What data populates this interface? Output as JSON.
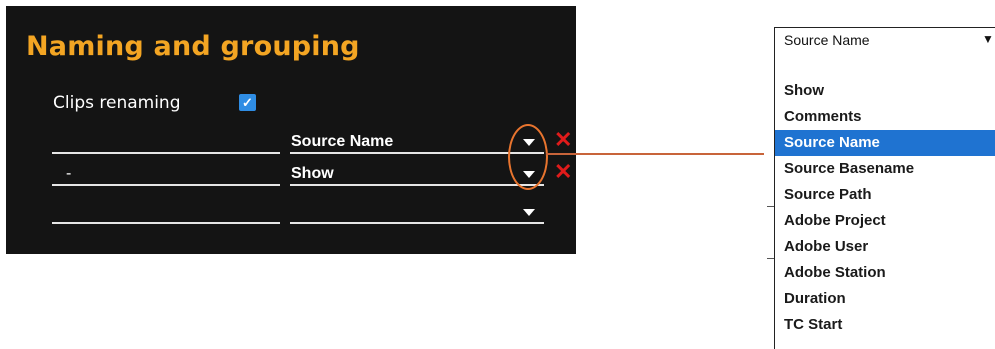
{
  "panel": {
    "title": "Naming and grouping",
    "clips_renaming_label": "Clips renaming",
    "clips_renaming_checked": true,
    "rows": [
      {
        "separator": "",
        "field": "Source Name"
      },
      {
        "separator": "-",
        "field": "Show"
      },
      {
        "separator": "",
        "field": ""
      }
    ],
    "checkbox_color": "#2f8de4",
    "title_color": "#f3a523",
    "delete_color": "#e01b1b",
    "icons": {
      "delete": "close-x-icon",
      "dropdown": "caret-down-icon",
      "check": "checkmark-icon"
    }
  },
  "dropdown": {
    "selected": "Source Name",
    "options": [
      "Show",
      "Comments",
      "Source Name",
      "Source Basename",
      "Source Path",
      "Adobe Project",
      "Adobe User",
      "Adobe Station",
      "Duration",
      "TC Start"
    ],
    "highlight_color": "#1f73d1"
  }
}
